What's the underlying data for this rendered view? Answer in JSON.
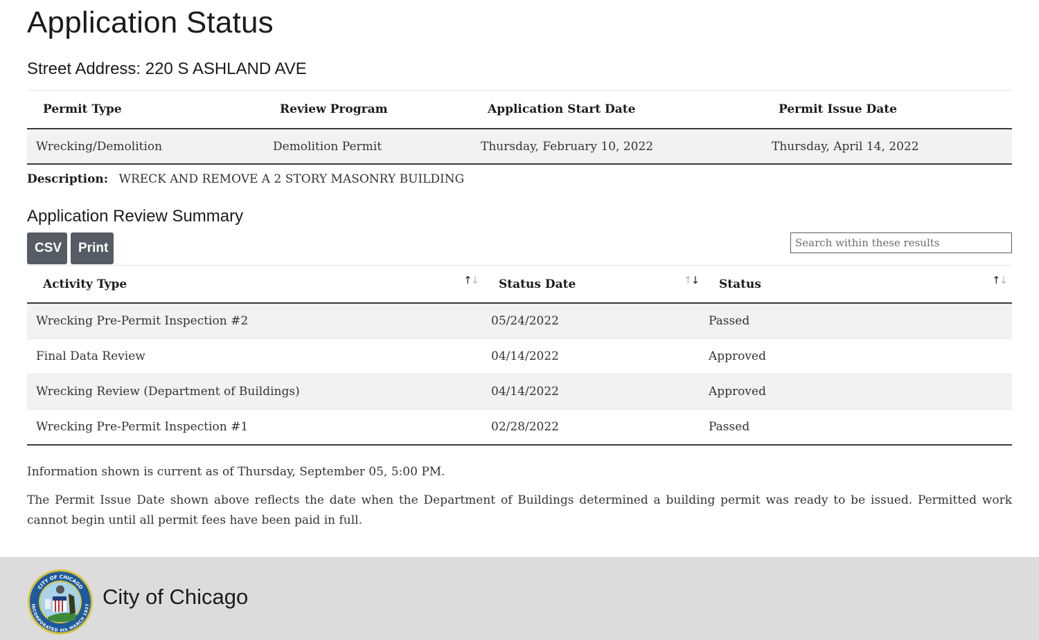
{
  "page": {
    "title": "Application Status",
    "street_address_label": "Street Address: 220 S ASHLAND AVE"
  },
  "permit": {
    "headers": [
      "Permit Type",
      "Review Program",
      "Application Start Date",
      "Permit Issue Date"
    ],
    "row": [
      "Wrecking/Demolition",
      "Demolition Permit",
      "Thursday, February 10, 2022",
      "Thursday, April 14, 2022"
    ],
    "description_label": "Description:",
    "description": "WRECK AND REMOVE A 2 STORY MASONRY BUILDING"
  },
  "review": {
    "title": "Application Review Summary",
    "csv_label": "CSV",
    "print_label": "Print",
    "search_placeholder": "Search within these results",
    "search_value": "",
    "sort_icon": "sort-arrows-icon",
    "sorted_column": "Status Date",
    "sort_direction": "descending",
    "headers": [
      "Activity Type",
      "Status Date",
      "Status"
    ],
    "rows": [
      [
        "Wrecking Pre-Permit Inspection #2",
        "05/24/2022",
        "Passed"
      ],
      [
        "Final Data Review",
        "04/14/2022",
        "Approved"
      ],
      [
        "Wrecking Review (Department of Buildings)",
        "04/14/2022",
        "Approved"
      ],
      [
        "Wrecking Pre-Permit Inspection #1",
        "02/28/2022",
        "Passed"
      ]
    ]
  },
  "info": {
    "current_as_of": "Information shown is current as of Thursday, September 05, 5:00 PM.",
    "issue_date_note": "The Permit Issue Date shown above reflects the date when the Department of Buildings determined a building permit was ready to be issued. Permitted work cannot begin until all permit fees have been paid in full."
  },
  "footer": {
    "logo": "city-seal-icon",
    "name": "City of Chicago",
    "seal_text_top": "CITY OF CHICAGO",
    "seal_text_bottom": "INCORPORATED 4th MARCH 1837"
  },
  "colors": {
    "button_bg": "#565c65",
    "footer_bg": "#dcdcdc",
    "row_stripe": "#f2f2f2",
    "seal_blue": "#1f5a9c",
    "seal_gold": "#d8c23a"
  }
}
